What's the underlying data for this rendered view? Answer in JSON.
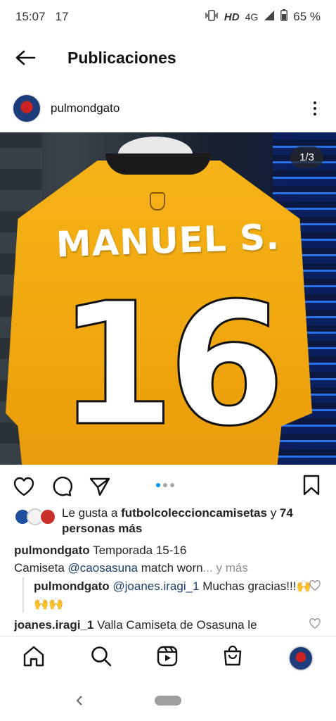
{
  "status_bar": {
    "time": "15:07",
    "notification": "17",
    "network": "HD",
    "signal": "4G",
    "battery": "65 %"
  },
  "header": {
    "title": "Publicaciones"
  },
  "post": {
    "username": "pulmondgato",
    "image_counter": "1/3",
    "jersey_name": "MANUEL S.",
    "jersey_number": "16",
    "carousel": {
      "current": 1,
      "total": 3
    }
  },
  "likes": {
    "prefix": "Le gusta a ",
    "user": "futbolcoleccioncamisetas",
    "middle": " y ",
    "count": "74 personas más"
  },
  "caption": {
    "user": "pulmondgato",
    "line1": " Temporada 15-16",
    "line2_prefix": "Camiseta ",
    "mention": "@caosasuna",
    "line2_suffix": " match worn",
    "more": "... y más"
  },
  "comments": [
    {
      "user": "pulmondgato",
      "mention": "@joanes.iragi_1",
      "text": " Muchas gracias!!!🙌🙌🙌"
    },
    {
      "user": "joanes.iragi_1",
      "text": " Valla Camiseta de Osasuna le"
    }
  ],
  "colors": {
    "link": "#1b3f6b",
    "accent_dot": "#0095f6",
    "shirt": "#f1a810"
  },
  "icons": {
    "back": "arrow-left-icon",
    "more": "more-vertical-icon",
    "like": "heart-icon",
    "comment": "comment-icon",
    "share": "send-icon",
    "save": "bookmark-icon",
    "home": "home-icon",
    "search": "search-icon",
    "reels": "reels-icon",
    "shop": "shop-icon"
  }
}
